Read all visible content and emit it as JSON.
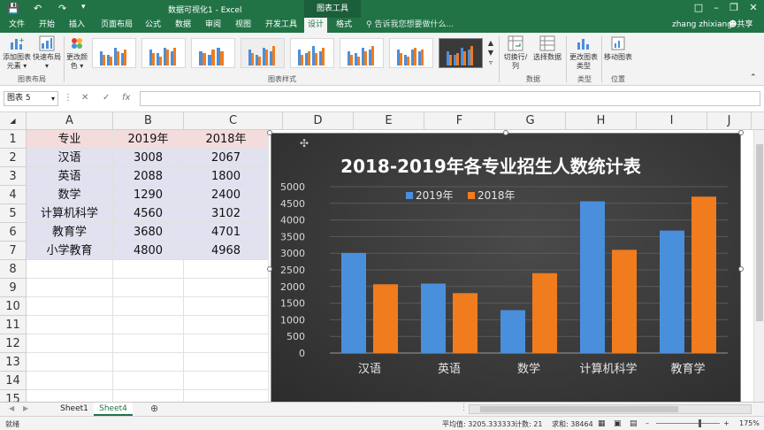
{
  "titlebar": {
    "title": "数据可视化1 - Excel",
    "context_tab": "图表工具",
    "save_icon": "save-icon",
    "undo_icon": "undo-icon",
    "redo_icon": "redo-icon",
    "customize_icon": "customize-quick-access-icon"
  },
  "tabs": [
    {
      "label": "文件"
    },
    {
      "label": "开始"
    },
    {
      "label": "插入"
    },
    {
      "label": "页面布局"
    },
    {
      "label": "公式"
    },
    {
      "label": "数据"
    },
    {
      "label": "审阅"
    },
    {
      "label": "视图"
    },
    {
      "label": "开发工具"
    },
    {
      "label": "设计"
    },
    {
      "label": "格式"
    }
  ],
  "tellme": "告诉我您想要做什么...",
  "user": "zhang zhixiang",
  "share": "共享",
  "ribbon": {
    "add_element": "添加图表元素 ▾",
    "quick_layout": "快速布局 ▾",
    "change_colors": "更改颜色 ▾",
    "switch_row_col": "切换行/列",
    "select_data": "选择数据",
    "change_type": "更改图表类型",
    "move_chart": "移动图表",
    "group_layouts": "图表布局",
    "group_styles": "图表样式",
    "group_data": "数据",
    "group_type": "类型",
    "group_location": "位置"
  },
  "formula": {
    "namebox": "图表 5",
    "fx": "fx",
    "cancel": "✕",
    "confirm": "✓"
  },
  "columns": [
    "A",
    "B",
    "C",
    "D",
    "E",
    "F",
    "G",
    "H",
    "I",
    "J"
  ],
  "rows": [
    "1",
    "2",
    "3",
    "4",
    "5",
    "6",
    "7",
    "8",
    "9",
    "10",
    "11",
    "12",
    "13",
    "14",
    "15"
  ],
  "table": {
    "header": [
      "专业",
      "2019年",
      "2018年"
    ],
    "data": [
      [
        "汉语",
        "3008",
        "2067"
      ],
      [
        "英语",
        "2088",
        "1800"
      ],
      [
        "数学",
        "1290",
        "2400"
      ],
      [
        "计算机科学",
        "4560",
        "3102"
      ],
      [
        "教育学",
        "3680",
        "4701"
      ],
      [
        "小学教育",
        "4800",
        "4968"
      ]
    ]
  },
  "chart_data": {
    "type": "bar",
    "title": "2018-2019年各专业招生人数统计表",
    "categories": [
      "汉语",
      "英语",
      "数学",
      "计算机科学",
      "教育学"
    ],
    "series": [
      {
        "name": "2019年",
        "values": [
          3008,
          2088,
          1290,
          4560,
          3680
        ],
        "color": "#4a8fdc"
      },
      {
        "name": "2018年",
        "values": [
          2067,
          1800,
          2400,
          3102,
          4701
        ],
        "color": "#f07c1e"
      }
    ],
    "ylim": [
      0,
      5000
    ],
    "yticks": [
      "0",
      "500",
      "1000",
      "1500",
      "2000",
      "2500",
      "3000",
      "3500",
      "4000",
      "4500",
      "5000"
    ],
    "grid": true,
    "legend": "top-center"
  },
  "sheets": [
    {
      "label": "Sheet1"
    },
    {
      "label": "Sheet4"
    }
  ],
  "status": {
    "ready": "就绪",
    "average": "平均值: 3205.333333",
    "count": "计数: 21",
    "sum": "求和: 38464",
    "zoom": "175%"
  }
}
